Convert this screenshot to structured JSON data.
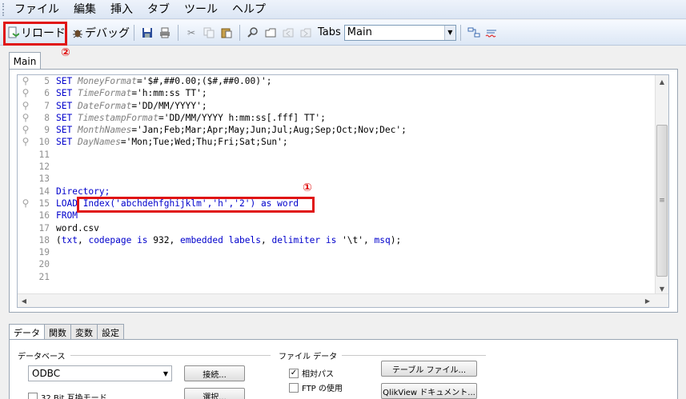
{
  "menu": [
    "ファイル",
    "編集",
    "挿入",
    "タブ",
    "ツール",
    "ヘルプ"
  ],
  "toolbar": {
    "reload_label": "リロード",
    "debug_label": "デバッグ",
    "tabs_label": "Tabs",
    "tab_select_value": "Main"
  },
  "markers": {
    "code": "①",
    "reload": "②"
  },
  "editor": {
    "tab_label": "Main",
    "lines": [
      {
        "n": "5",
        "pin": true,
        "kw": "SET ",
        "var": "MoneyFormat",
        "rest": "='$#,##0.00;($#,##0.00)';"
      },
      {
        "n": "6",
        "pin": true,
        "kw": "SET ",
        "var": "TimeFormat",
        "rest": "='h:mm:ss TT';"
      },
      {
        "n": "7",
        "pin": true,
        "kw": "SET ",
        "var": "DateFormat",
        "rest": "='DD/MM/YYYY';"
      },
      {
        "n": "8",
        "pin": true,
        "kw": "SET ",
        "var": "TimestampFormat",
        "rest": "='DD/MM/YYYY h:mm:ss[.fff] TT';"
      },
      {
        "n": "9",
        "pin": true,
        "kw": "SET ",
        "var": "MonthNames",
        "rest": "='Jan;Feb;Mar;Apr;May;Jun;Jul;Aug;Sep;Oct;Nov;Dec';"
      },
      {
        "n": "10",
        "pin": true,
        "kw": "SET ",
        "var": "DayNames",
        "rest": "='Mon;Tue;Wed;Thu;Fri;Sat;Sun';"
      },
      {
        "n": "11",
        "pin": false,
        "text": ""
      },
      {
        "n": "12",
        "pin": false,
        "text": ""
      },
      {
        "n": "13",
        "pin": false,
        "text": ""
      },
      {
        "n": "14",
        "pin": false,
        "kwline": "Directory;"
      },
      {
        "n": "15",
        "pin": true,
        "load": true
      },
      {
        "n": "16",
        "pin": false,
        "kwline": "FROM"
      },
      {
        "n": "17",
        "pin": false,
        "text": "word.csv"
      },
      {
        "n": "18",
        "pin": false,
        "fmt": true
      },
      {
        "n": "19",
        "pin": false,
        "text": ""
      },
      {
        "n": "20",
        "pin": false,
        "text": ""
      },
      {
        "n": "21",
        "pin": false,
        "text": ""
      }
    ],
    "load_keyword": "LOAD ",
    "load_expr": "Index('abchdehfghijklm','h','2') as word",
    "fmt_parts": [
      "(",
      "txt",
      ", ",
      "codepage is",
      " 932, ",
      "embedded labels",
      ", ",
      "delimiter is",
      " '\\t', ",
      "msq",
      ");"
    ]
  },
  "bottom": {
    "tabs": [
      "データ",
      "関数",
      "変数",
      "設定"
    ],
    "database_group": "データベース",
    "database_value": "ODBC",
    "connect_button": "接続...",
    "select_button": "選択...",
    "compat_checkbox": "32 Bit 互換モード",
    "file_group": "ファイル データ",
    "relative_path": "相対パス",
    "ftp": "FTP の使用",
    "table_file_button": "テーブル ファイル...",
    "qv_doc_button": "QlikView ドキュメント..."
  }
}
